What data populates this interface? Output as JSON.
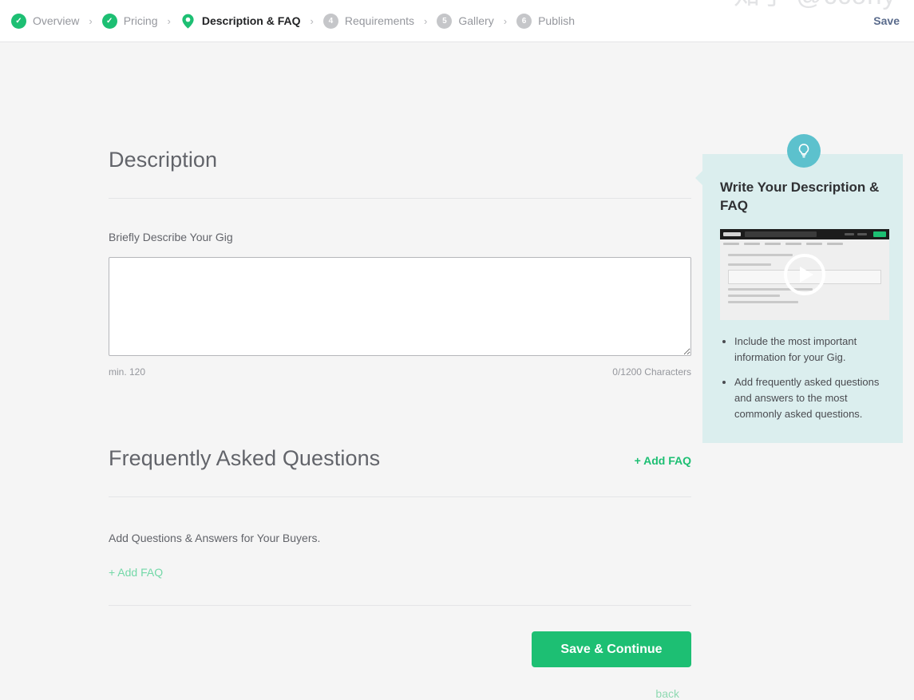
{
  "header": {
    "steps": [
      {
        "label": "Overview",
        "state": "done",
        "badge": "✓"
      },
      {
        "label": "Pricing",
        "state": "done",
        "badge": "✓"
      },
      {
        "label": "Description & FAQ",
        "state": "current",
        "badge": ""
      },
      {
        "label": "Requirements",
        "state": "todo",
        "badge": "4"
      },
      {
        "label": "Gallery",
        "state": "todo",
        "badge": "5"
      },
      {
        "label": "Publish",
        "state": "todo",
        "badge": "6"
      }
    ],
    "separator": "›",
    "save_label": "Save"
  },
  "description": {
    "title": "Description",
    "field_label": "Briefly Describe Your Gig",
    "textarea_value": "",
    "textarea_placeholder": "",
    "min_note": "min. 120",
    "counter": "0/1200 Characters"
  },
  "faq": {
    "title": "Frequently Asked Questions",
    "add_top_label": "+ Add FAQ",
    "note": "Add Questions & Answers for Your Buyers.",
    "add_bottom_label": "+ Add FAQ"
  },
  "actions": {
    "primary_label": "Save & Continue",
    "back_label": "back"
  },
  "tip": {
    "icon": "lightbulb-icon",
    "title": "Write Your Description & FAQ",
    "video_alt": "description-faq-tutorial-video",
    "play_icon": "play-icon",
    "bullets": [
      "Include the most important information for your Gig.",
      "Add frequently asked questions and answers to the most commonly asked questions."
    ]
  },
  "watermark": {
    "text": "知乎 @ccony"
  },
  "colors": {
    "brand_green": "#1dbf73",
    "tip_bg": "#dbeeee",
    "tip_icon": "#5cc1cd",
    "page_bg": "#f5f5f5",
    "muted_text": "#95979d"
  }
}
